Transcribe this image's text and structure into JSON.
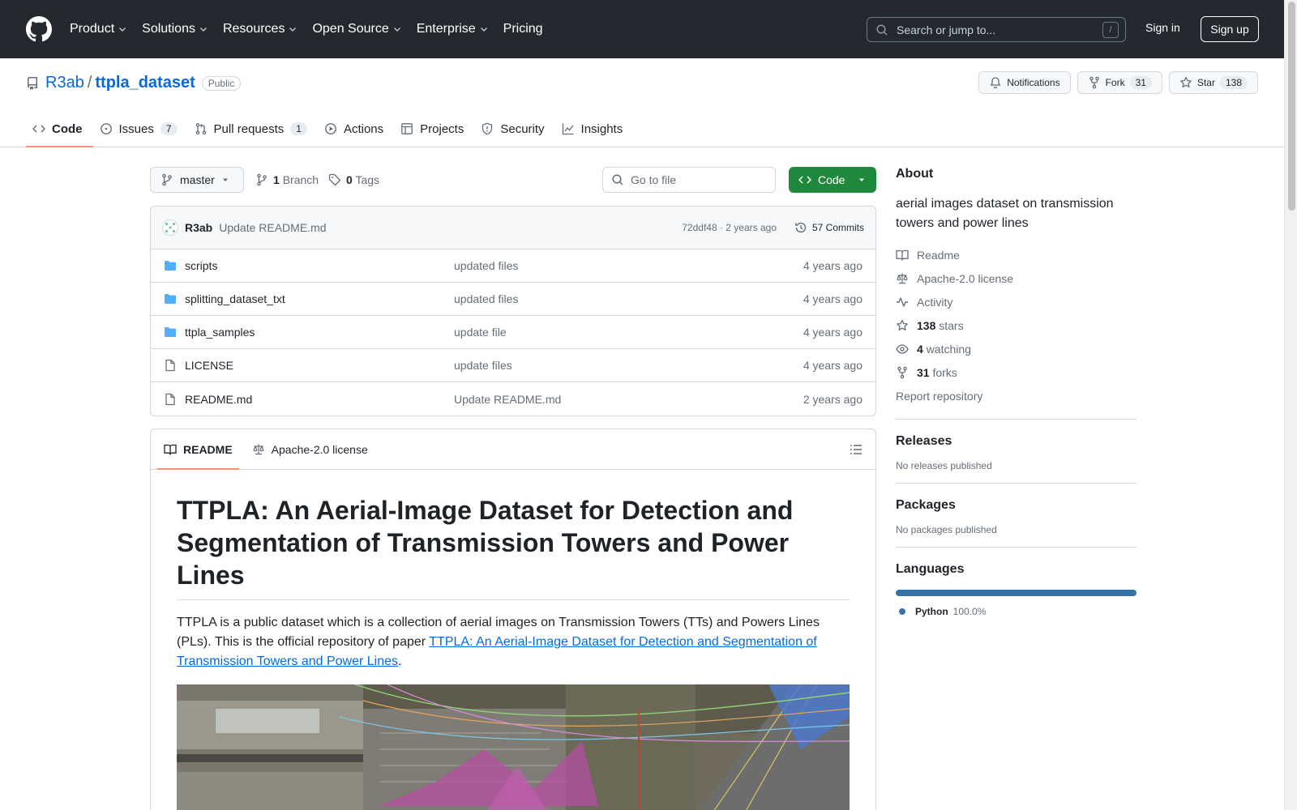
{
  "header": {
    "nav": [
      "Product",
      "Solutions",
      "Resources",
      "Open Source",
      "Enterprise",
      "Pricing"
    ],
    "search_placeholder": "Search or jump to...",
    "search_key": "/",
    "sign_in": "Sign in",
    "sign_up": "Sign up"
  },
  "repo": {
    "owner": "R3ab",
    "separator": "/",
    "name": "ttpla_dataset",
    "visibility": "Public",
    "notifications": "Notifications",
    "fork_label": "Fork",
    "fork_count": "31",
    "star_label": "Star",
    "star_count": "138"
  },
  "tabs": [
    {
      "label": "Code",
      "icon": "code-icon"
    },
    {
      "label": "Issues",
      "count": "7",
      "icon": "issue-icon"
    },
    {
      "label": "Pull requests",
      "count": "1",
      "icon": "pull-request-icon"
    },
    {
      "label": "Actions",
      "icon": "play-icon"
    },
    {
      "label": "Projects",
      "icon": "table-icon"
    },
    {
      "label": "Security",
      "icon": "shield-icon"
    },
    {
      "label": "Insights",
      "icon": "graph-icon"
    }
  ],
  "filenav": {
    "branch": "master",
    "branch_count": "1",
    "branch_label": "Branch",
    "tag_count": "0",
    "tag_label": "Tags",
    "goto_placeholder": "Go to file",
    "code_button": "Code"
  },
  "commit": {
    "author": "R3ab",
    "message": "Update README.md",
    "meta": "72ddf48 · 2 years ago",
    "commits": "57 Commits"
  },
  "files": [
    {
      "name": "scripts",
      "type": "folder",
      "message": "updated files",
      "age": "4 years ago"
    },
    {
      "name": "splitting_dataset_txt",
      "type": "folder",
      "message": "updated files",
      "age": "4 years ago"
    },
    {
      "name": "ttpla_samples",
      "type": "folder",
      "message": "update file",
      "age": "4 years ago"
    },
    {
      "name": "LICENSE",
      "type": "file",
      "message": "update files",
      "age": "4 years ago"
    },
    {
      "name": "README.md",
      "type": "file",
      "message": "Update README.md",
      "age": "2 years ago"
    }
  ],
  "readme": {
    "tab_readme": "README",
    "tab_license": "Apache-2.0 license",
    "title": "TTPLA: An Aerial-Image Dataset for Detection and Segmentation of Transmission Towers and Power Lines",
    "para_text": "TTPLA is a public dataset which is a collection of aerial images on Transmission Towers (TTs) and Powers Lines (PLs). This is the official repository of paper ",
    "para_link": "TTPLA: An Aerial-Image Dataset for Detection and Segmentation of Transmission Towers and Power Lines",
    "para_end": "."
  },
  "about": {
    "heading": "About",
    "description": "aerial images dataset on transmission towers and power lines",
    "readme": "Readme",
    "license": "Apache-2.0 license",
    "activity": "Activity",
    "stars_count": "138",
    "stars_label": "stars",
    "watching_count": "4",
    "watching_label": "watching",
    "forks_count": "31",
    "forks_label": "forks",
    "report": "Report repository"
  },
  "releases": {
    "heading": "Releases",
    "note": "No releases published"
  },
  "packages": {
    "heading": "Packages",
    "note": "No packages published"
  },
  "languages": {
    "heading": "Languages",
    "items": [
      {
        "name": "Python",
        "percent": "100.0%",
        "share": 1.0,
        "color": "#3572a5"
      }
    ]
  },
  "colors": {
    "header_bg": "#24292f",
    "accent": "#0969da",
    "code_green": "#1f883d",
    "tab_underline": "#fd8c73"
  }
}
